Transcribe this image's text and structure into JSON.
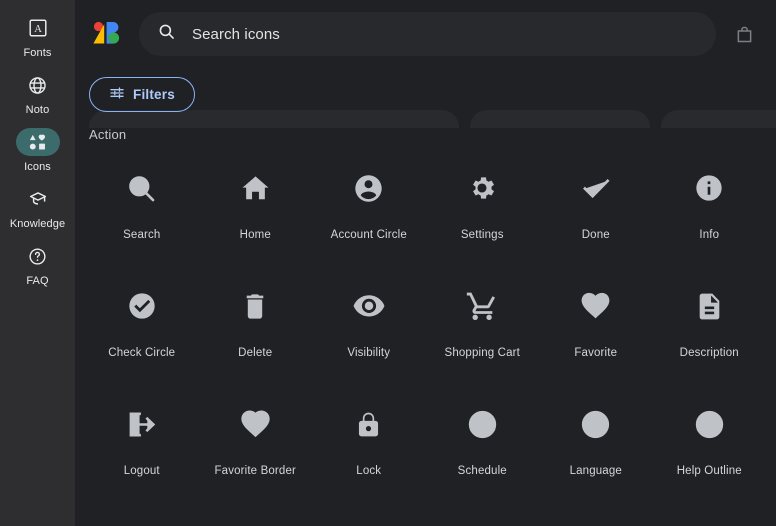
{
  "colors": {
    "page_bg": "#202124",
    "sidebar_bg": "#2e2e30",
    "search_bg": "#28292c",
    "accent_blue": "#8ab4f8",
    "accent_blue_text": "#aecbfa",
    "active_pill": "#3b6b6b",
    "icon_grey": "#bfc3c8",
    "logo_red": "#ea4335",
    "logo_yellow": "#fbbc04",
    "logo_blue": "#4285f4",
    "logo_green": "#34a853"
  },
  "sidebar": {
    "items": [
      {
        "id": "fonts",
        "label": "Fonts",
        "icon": "fonts-icon",
        "active": false
      },
      {
        "id": "noto",
        "label": "Noto",
        "icon": "globe-icon",
        "active": false
      },
      {
        "id": "icons",
        "label": "Icons",
        "icon": "shapes-icon",
        "active": true
      },
      {
        "id": "knowledge",
        "label": "Knowledge",
        "icon": "graduation-cap-icon",
        "active": false
      },
      {
        "id": "faq",
        "label": "FAQ",
        "icon": "help-circle-icon",
        "active": false
      }
    ]
  },
  "header": {
    "logo_name": "google-fonts-logo",
    "search": {
      "placeholder": "Search icons",
      "value": "",
      "icon": "search-icon"
    },
    "cart_icon": "shopping-bag-icon"
  },
  "toolbar": {
    "filters_label": "Filters",
    "filters_icon": "tune-icon",
    "skeleton_chip_widths": [
      370,
      180,
      222,
      215,
      110
    ]
  },
  "content": {
    "section_title": "Action",
    "icons": [
      {
        "name": "Search",
        "glyph": "search-icon"
      },
      {
        "name": "Home",
        "glyph": "home-icon"
      },
      {
        "name": "Account Circle",
        "glyph": "account-circle-icon"
      },
      {
        "name": "Settings",
        "glyph": "settings-gear-icon"
      },
      {
        "name": "Done",
        "glyph": "check-icon"
      },
      {
        "name": "Info",
        "glyph": "info-icon"
      },
      {
        "name": "Check Circle",
        "glyph": "check-circle-icon"
      },
      {
        "name": "Delete",
        "glyph": "trash-icon"
      },
      {
        "name": "Visibility",
        "glyph": "eye-icon"
      },
      {
        "name": "Shopping Cart",
        "glyph": "shopping-cart-icon"
      },
      {
        "name": "Favorite",
        "glyph": "heart-filled-icon"
      },
      {
        "name": "Description",
        "glyph": "document-lines-icon"
      },
      {
        "name": "Logout",
        "glyph": "logout-icon"
      },
      {
        "name": "Favorite Border",
        "glyph": "heart-outline-icon"
      },
      {
        "name": "Lock",
        "glyph": "lock-icon"
      },
      {
        "name": "Schedule",
        "glyph": "clock-icon"
      },
      {
        "name": "Language",
        "glyph": "globe-icon"
      },
      {
        "name": "Help Outline",
        "glyph": "help-outline-icon"
      }
    ]
  }
}
